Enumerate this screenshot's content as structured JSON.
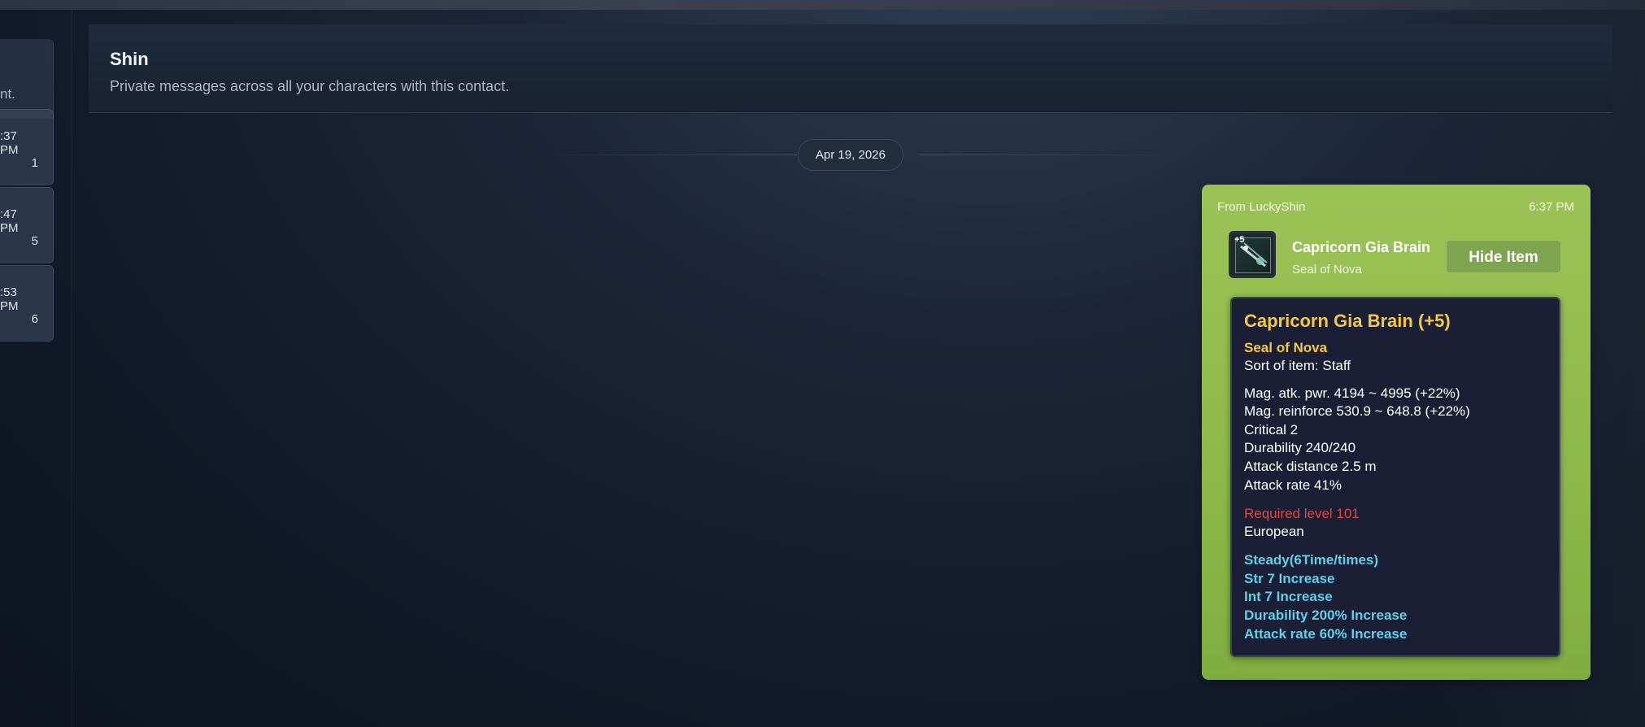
{
  "sidebar": {
    "hint_fragment": "nt.",
    "threads": [
      {
        "time": ":37 PM",
        "count": "1"
      },
      {
        "time": ":47 PM",
        "count": "5"
      },
      {
        "time": ":53 PM",
        "count": "6"
      }
    ]
  },
  "header": {
    "title": "Shin",
    "subtitle": "Private messages across all your characters with this contact."
  },
  "date_divider": "Apr 19, 2026",
  "message": {
    "from": "From LuckyShin",
    "time": "6:37 PM",
    "bubble_color": "#9cc256",
    "item": {
      "icon": "staff-item-icon",
      "plus_badge": "+5",
      "name": "Capricorn Gia Brain",
      "subtitle": "Seal of Nova",
      "hide_button": "Hide Item"
    },
    "tooltip": {
      "title": "Capricorn Gia Brain (+5)",
      "set_name": "Seal of Nova",
      "sort": "Sort of item: Staff",
      "stats": [
        "Mag. atk. pwr. 4194 ~ 4995 (+22%)",
        "Mag. reinforce 530.9 ~ 648.8 (+22%)",
        "Critical 2",
        "Durability 240/240",
        "Attack distance 2.5 m",
        "Attack rate 41%"
      ],
      "required_level": "Required level 101",
      "race": "European",
      "blues": [
        "Steady(6Time/times)",
        "Str 7 Increase",
        "Int 7 Increase",
        "Durability 200% Increase",
        "Attack rate 60% Increase"
      ],
      "colors": {
        "title": "#f5c842",
        "required": "#e0473f",
        "blue_stat": "#5fd0ea"
      }
    }
  }
}
